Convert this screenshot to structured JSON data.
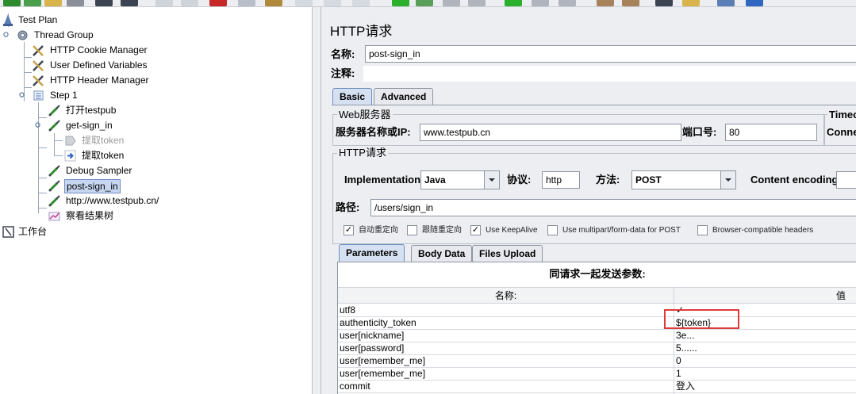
{
  "tree": {
    "items": [
      {
        "label": "Test Plan",
        "icon": "test-plan-icon"
      },
      {
        "label": "Thread Group",
        "icon": "gear-icon"
      },
      {
        "label": "HTTP Cookie Manager",
        "icon": "wrench-icon"
      },
      {
        "label": "User Defined Variables",
        "icon": "wrench-icon"
      },
      {
        "label": "HTTP Header Manager",
        "icon": "wrench-icon"
      },
      {
        "label": "Step 1",
        "icon": "controller-icon"
      },
      {
        "label": "打开testpub",
        "icon": "pipette-icon"
      },
      {
        "label": "get-sign_in",
        "icon": "pipette-icon"
      },
      {
        "label": "提取token",
        "icon": "extractor-icon"
      },
      {
        "label": "提取token",
        "icon": "extractor-icon"
      },
      {
        "label": "Debug Sampler",
        "icon": "pipette-icon"
      },
      {
        "label": "post-sign_in",
        "icon": "pipette-icon"
      },
      {
        "label": "http://www.testpub.cn/",
        "icon": "pipette-icon"
      },
      {
        "label": "察看结果树",
        "icon": "chart-icon"
      },
      {
        "label": "工作台",
        "icon": "workbench-icon"
      }
    ]
  },
  "panel": {
    "title": "HTTP请求",
    "name_label": "名称:",
    "name_value": "post-sign_in",
    "comment_label": "注释:",
    "comment_value": "",
    "tabs": [
      "Basic",
      "Advanced"
    ],
    "web_server": {
      "title": "Web服务器",
      "server_label": "服务器名称或IP:",
      "server_value": "www.testpub.cn",
      "port_label": "端口号:",
      "port_value": "80"
    },
    "timeouts": {
      "title": "Timeo",
      "connect_label": "Conne"
    },
    "http_request": {
      "title": "HTTP请求",
      "implementation_label": "Implementation:",
      "implementation_value": "Java",
      "protocol_label": "协议:",
      "protocol_value": "http",
      "method_label": "方法:",
      "method_value": "POST",
      "encoding_label": "Content encoding:",
      "encoding_value": "",
      "path_label": "路径:",
      "path_value": "/users/sign_in"
    },
    "options": [
      {
        "label": "自动重定向",
        "checked": true
      },
      {
        "label": "跟随重定向",
        "checked": false
      },
      {
        "label": "Use KeepAlive",
        "checked": true
      },
      {
        "label": "Use multipart/form-data for POST",
        "checked": false
      },
      {
        "label": "Browser-compatible headers",
        "checked": false
      }
    ],
    "sub_tabs": [
      "Parameters",
      "Body Data",
      "Files Upload"
    ],
    "params_title": "同请求一起发送参数:",
    "columns": [
      "名称:",
      "值"
    ],
    "rows": [
      {
        "name": "utf8",
        "value": "✓"
      },
      {
        "name": "authenticity_token",
        "value": "${token}"
      },
      {
        "name": "user[nickname]",
        "value": "3e..."
      },
      {
        "name": "user[password]",
        "value": "5......"
      },
      {
        "name": "user[remember_me]",
        "value": "0"
      },
      {
        "name": "user[remember_me]",
        "value": "1"
      },
      {
        "name": "commit",
        "value": "登入"
      }
    ]
  },
  "colors": {
    "panel_bg": "#eceef2",
    "selection_bg": "#c6d6f0",
    "highlight": "#e03a3a"
  }
}
